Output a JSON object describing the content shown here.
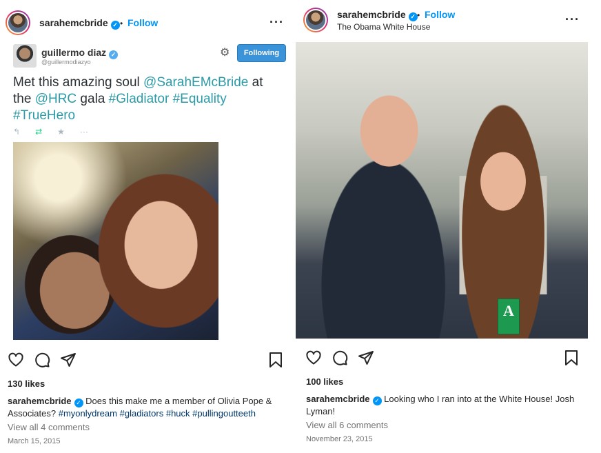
{
  "left_post": {
    "username": "sarahemcbride",
    "follow_label": "Follow",
    "dot": "•",
    "more": "···",
    "tweet": {
      "name": "guillermo diaz",
      "handle": "@guillermodiazyo",
      "following_label": "Following",
      "text_parts": [
        {
          "t": "Met this amazing soul ",
          "hl": false
        },
        {
          "t": "@SarahEMcBride",
          "hl": true
        },
        {
          "t": " at the ",
          "hl": false
        },
        {
          "t": "@HRC",
          "hl": true
        },
        {
          "t": " gala ",
          "hl": false
        },
        {
          "t": "#Gladiator",
          "hl": true
        },
        {
          "t": " ",
          "hl": false
        },
        {
          "t": "#Equality",
          "hl": true
        },
        {
          "t": " ",
          "hl": false
        },
        {
          "t": "#TrueHero",
          "hl": true
        }
      ],
      "actions": {
        "reply": "↰",
        "retweet": "⇄",
        "favorite": "★",
        "more": "···"
      }
    },
    "likes": "130 likes",
    "caption_user": "sarahemcbride",
    "caption_text": "Does this make me a member of Olivia Pope & Associates?",
    "caption_tags": [
      "#myonlydream",
      "#gladiators",
      "#huck",
      "#pullingoutteeth"
    ],
    "comments": "View all 4 comments",
    "date": "March 15, 2015"
  },
  "right_post": {
    "username": "sarahemcbride",
    "follow_label": "Follow",
    "dot": "•",
    "location": "The Obama White House",
    "more": "···",
    "badge_letter": "A",
    "likes": "100 likes",
    "caption_user": "sarahemcbride",
    "caption_text": "Looking who I ran into at the White House! Josh Lyman!",
    "comments": "View all 6 comments",
    "date": "November 23, 2015"
  },
  "colors": {
    "accent": "#0095f6",
    "text": "#262626",
    "muted": "#737373",
    "hashtag": "#00376b",
    "tweet_highlight": "#2b9ba8"
  }
}
